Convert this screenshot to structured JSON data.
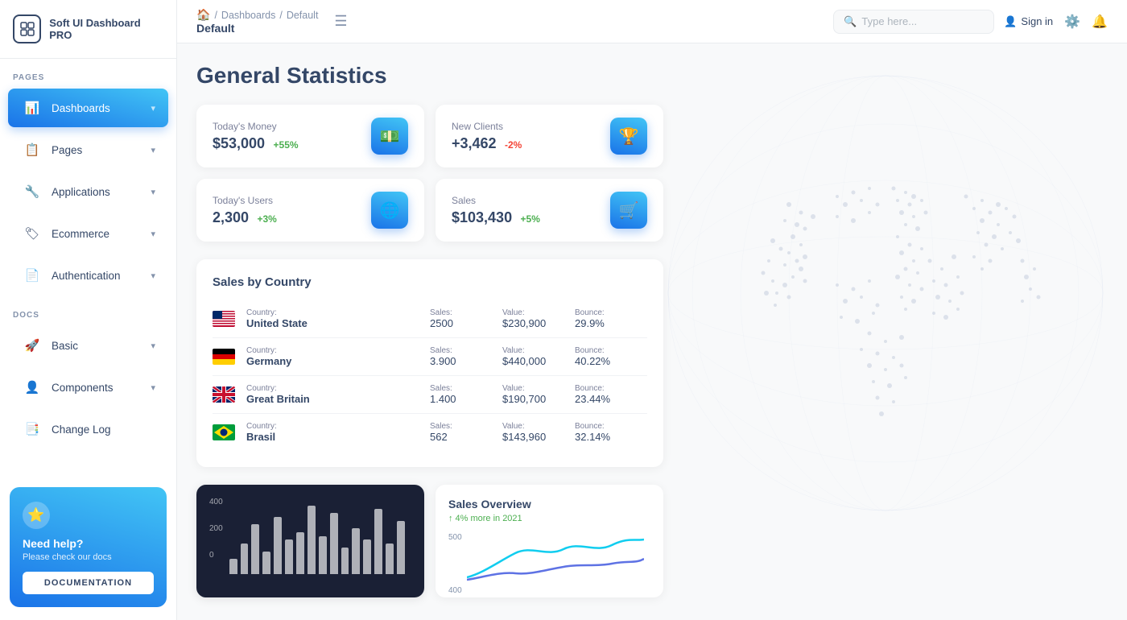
{
  "app": {
    "name": "Soft UI Dashboard PRO"
  },
  "topbar": {
    "breadcrumb": {
      "home_icon": "🏠",
      "separator": "/",
      "parent": "Dashboards",
      "current": "Default"
    },
    "search_placeholder": "Type here...",
    "sign_in_label": "Sign in",
    "hamburger_icon": "☰"
  },
  "sidebar": {
    "sections": [
      {
        "label": "PAGES",
        "items": [
          {
            "id": "dashboards",
            "label": "Dashboards",
            "icon": "📊",
            "active": true,
            "chevron": "▾"
          },
          {
            "id": "pages",
            "label": "Pages",
            "icon": "📋",
            "active": false,
            "chevron": "▾"
          },
          {
            "id": "applications",
            "label": "Applications",
            "icon": "🔧",
            "active": false,
            "chevron": "▾"
          },
          {
            "id": "ecommerce",
            "label": "Ecommerce",
            "icon": "🏷",
            "active": false,
            "chevron": "▾"
          },
          {
            "id": "authentication",
            "label": "Authentication",
            "icon": "📄",
            "active": false,
            "chevron": "▾"
          }
        ]
      },
      {
        "label": "DOCS",
        "items": [
          {
            "id": "basic",
            "label": "Basic",
            "icon": "🚀",
            "active": false,
            "chevron": "▾"
          },
          {
            "id": "components",
            "label": "Components",
            "icon": "👤",
            "active": false,
            "chevron": "▾"
          },
          {
            "id": "changelog",
            "label": "Change Log",
            "icon": "📑",
            "active": false,
            "chevron": ""
          }
        ]
      }
    ],
    "help_card": {
      "title": "Need help?",
      "subtitle": "Please check our docs",
      "button_label": "DOCUMENTATION"
    }
  },
  "main": {
    "page_title": "General Statistics",
    "stats": [
      {
        "label": "Today's Money",
        "value": "$53,000",
        "change": "+55%",
        "change_type": "positive",
        "icon": "💵"
      },
      {
        "label": "New Clients",
        "value": "+3,462",
        "change": "-2%",
        "change_type": "negative",
        "icon": "🏆"
      },
      {
        "label": "Today's Users",
        "value": "2,300",
        "change": "+3%",
        "change_type": "positive",
        "icon": "🌐"
      },
      {
        "label": "Sales",
        "value": "$103,430",
        "change": "+5%",
        "change_type": "positive",
        "icon": "🛒"
      }
    ],
    "sales_by_country": {
      "title": "Sales by Country",
      "columns": {
        "country": "Country:",
        "sales": "Sales:",
        "value": "Value:",
        "bounce": "Bounce:"
      },
      "rows": [
        {
          "country": "United State",
          "flag": "us",
          "sales": "2500",
          "value": "$230,900",
          "bounce": "29.9%"
        },
        {
          "country": "Germany",
          "flag": "de",
          "sales": "3.900",
          "value": "$440,000",
          "bounce": "40.22%"
        },
        {
          "country": "Great Britain",
          "flag": "gb",
          "sales": "1.400",
          "value": "$190,700",
          "bounce": "23.44%"
        },
        {
          "country": "Brasil",
          "flag": "br",
          "sales": "562",
          "value": "$143,960",
          "bounce": "32.14%"
        }
      ]
    },
    "bar_chart": {
      "y_labels": [
        "400",
        "200",
        "0"
      ],
      "bars": [
        20,
        35,
        55,
        30,
        65,
        40,
        50,
        80,
        45,
        70,
        30,
        55,
        40,
        75,
        35,
        60
      ]
    },
    "sales_overview": {
      "title": "Sales Overview",
      "subtitle": "4% more in 2021",
      "y_labels": [
        "500",
        "400"
      ]
    }
  }
}
